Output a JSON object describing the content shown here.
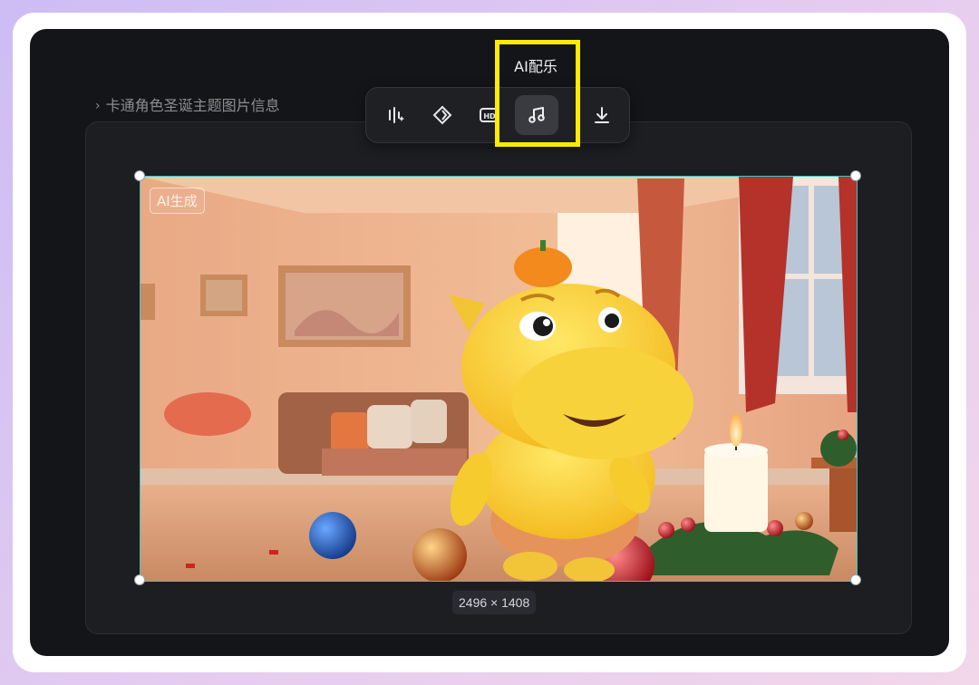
{
  "breadcrumb": {
    "chevron": "›",
    "title": "卡通角色圣诞主题图片信息"
  },
  "toolbar": {
    "tooltip": "AI配乐",
    "buttons": [
      {
        "icon": "sparkle-wand-icon"
      },
      {
        "icon": "diamond-icon"
      },
      {
        "icon": "hd-icon",
        "label": "HD"
      },
      {
        "icon": "music-note-icon"
      },
      {
        "icon": "download-icon"
      }
    ],
    "active_index": 3
  },
  "canvas": {
    "ai_badge": "AI生成",
    "dimensions": "2496 × 1408"
  },
  "colors": {
    "highlight": "#ffea00",
    "selection_border": "#3ec5c5",
    "window_bg": "#141518",
    "panel_bg": "#1d1e22"
  }
}
